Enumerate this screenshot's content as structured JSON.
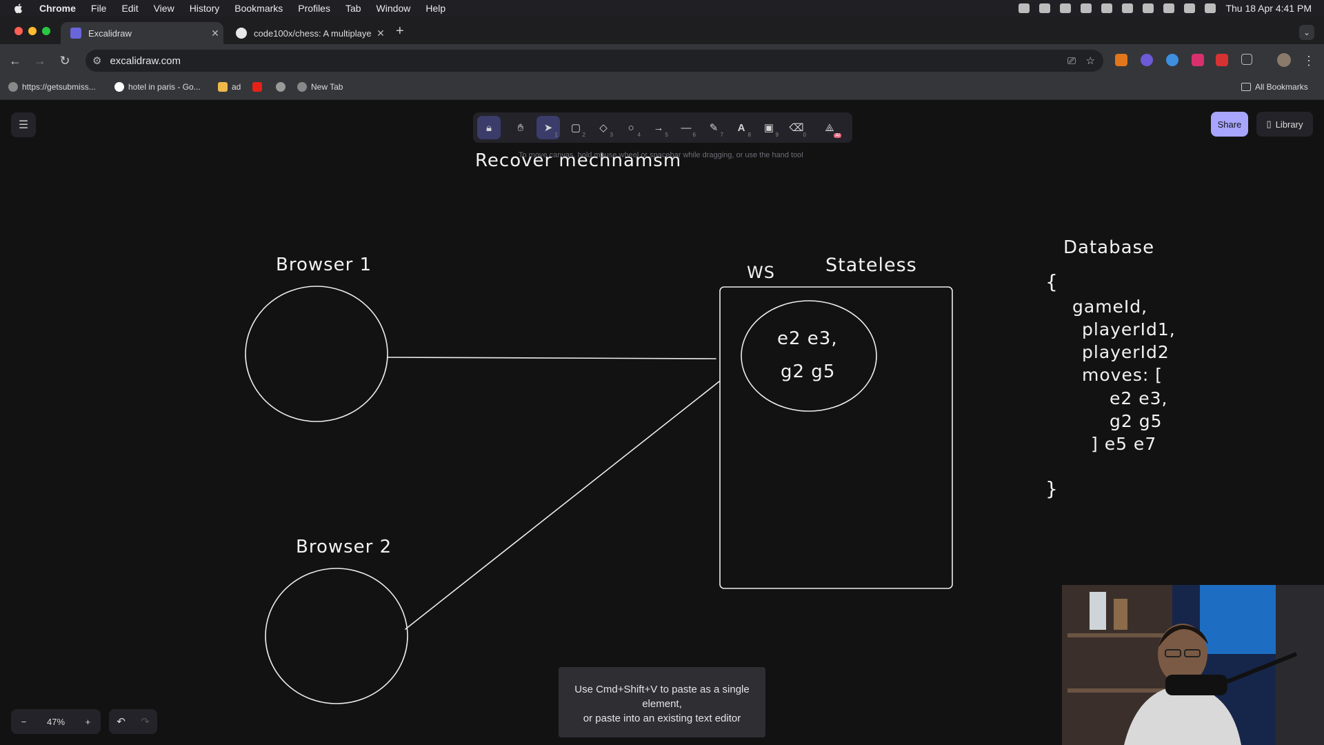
{
  "menubar": {
    "app": "Chrome",
    "items": [
      "File",
      "Edit",
      "View",
      "History",
      "Bookmarks",
      "Profiles",
      "Tab",
      "Window",
      "Help"
    ],
    "datetime": "Thu 18 Apr  4:41 PM"
  },
  "tabs": [
    {
      "title": "Excalidraw",
      "active": true
    },
    {
      "title": "code100x/chess: A multiplaye",
      "active": false
    }
  ],
  "address": {
    "url": "excalidraw.com"
  },
  "bookmarks": {
    "items": [
      "https://getsubmiss...",
      "hotel in paris - Go...",
      "ad",
      "New Tab"
    ],
    "all": "All Bookmarks"
  },
  "toolbar": {
    "hint": "To move canvas, hold mouse wheel or spacebar while dragging, or use the hand tool",
    "tool_numbers": [
      "1",
      "2",
      "3",
      "4",
      "5",
      "6",
      "7",
      "8",
      "9",
      "0"
    ],
    "ai_badge": "AI"
  },
  "actions": {
    "share": "Share",
    "library": "Library"
  },
  "zoom": {
    "level": "47%",
    "minus": "−",
    "plus": "+"
  },
  "drawing": {
    "title": "Recover mechnamsm",
    "browser1": "Browser 1",
    "browser2": "Browser 2",
    "ws": "WS",
    "stateless": "Stateless",
    "moves_inner_1": "e2 e3,",
    "moves_inner_2": "g2 g5",
    "database": "Database",
    "db_lines": [
      "{",
      "gameId,",
      "playerId1,",
      "playerId2",
      "moves: [",
      "e2 e3,",
      "g2 g5",
      "] e5 e7",
      "}"
    ]
  },
  "toast": {
    "line1": "Use Cmd+Shift+V to paste as a single element,",
    "line2": "or paste into an existing text editor"
  },
  "colors": {
    "accent": "#a8a5ff",
    "canvas": "#121212",
    "selected_tool": "#3c3c6a"
  }
}
